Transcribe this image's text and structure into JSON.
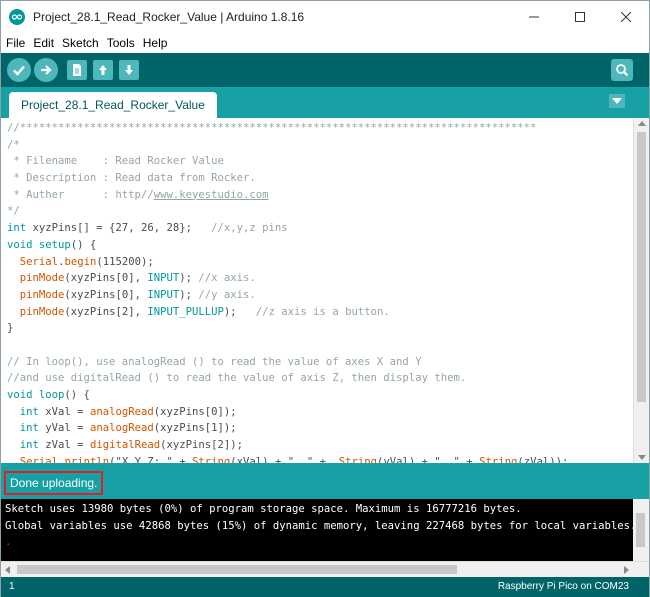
{
  "window": {
    "title": "Project_28.1_Read_Rocker_Value | Arduino 1.8.16"
  },
  "menu": [
    "File",
    "Edit",
    "Sketch",
    "Tools",
    "Help"
  ],
  "toolbar": {
    "verify_icon": "check-icon",
    "upload_icon": "arrow-right-icon",
    "new_icon": "document-icon",
    "open_icon": "arrow-up-icon",
    "save_icon": "arrow-down-icon",
    "serial_icon": "magnifier-icon"
  },
  "tab": {
    "label": "Project_28.1_Read_Rocker_Value"
  },
  "code_lines": [
    [
      [
        "c-comment",
        "//*********************************************************************************"
      ]
    ],
    [
      [
        "c-comment",
        "/*"
      ]
    ],
    [
      [
        "c-comment",
        " * Filename    : Read Rocker Value"
      ]
    ],
    [
      [
        "c-comment",
        " * Description : Read data from Rocker."
      ]
    ],
    [
      [
        "c-comment",
        " * Auther      : http//"
      ],
      [
        "c-url",
        "www.keyestudio.com"
      ]
    ],
    [
      [
        "c-comment",
        "*/"
      ]
    ],
    [
      [
        "c-kw",
        "int"
      ],
      [
        "c-plain",
        " xyzPins[] = {27, 26, 28};   "
      ],
      [
        "c-comment",
        "//x,y,z pins"
      ]
    ],
    [
      [
        "c-kw",
        "void"
      ],
      [
        "c-plain",
        " "
      ],
      [
        "c-kw",
        "setup"
      ],
      [
        "c-plain",
        "() {"
      ]
    ],
    [
      [
        "c-plain",
        "  "
      ],
      [
        "c-fn",
        "Serial"
      ],
      [
        "c-plain",
        "."
      ],
      [
        "c-fn",
        "begin"
      ],
      [
        "c-plain",
        "(115200);"
      ]
    ],
    [
      [
        "c-plain",
        "  "
      ],
      [
        "c-fn",
        "pinMode"
      ],
      [
        "c-plain",
        "(xyzPins[0], "
      ],
      [
        "c-kw",
        "INPUT"
      ],
      [
        "c-plain",
        "); "
      ],
      [
        "c-comment",
        "//x axis."
      ]
    ],
    [
      [
        "c-plain",
        "  "
      ],
      [
        "c-fn",
        "pinMode"
      ],
      [
        "c-plain",
        "(xyzPins[0], "
      ],
      [
        "c-kw",
        "INPUT"
      ],
      [
        "c-plain",
        "); "
      ],
      [
        "c-comment",
        "//y axis."
      ]
    ],
    [
      [
        "c-plain",
        "  "
      ],
      [
        "c-fn",
        "pinMode"
      ],
      [
        "c-plain",
        "(xyzPins[2], "
      ],
      [
        "c-kw",
        "INPUT_PULLUP"
      ],
      [
        "c-plain",
        ");   "
      ],
      [
        "c-comment",
        "//z axis is a button."
      ]
    ],
    [
      [
        "c-plain",
        "}"
      ]
    ],
    [
      [
        "c-plain",
        ""
      ]
    ],
    [
      [
        "c-comment",
        "// In loop(), use analogRead () to read the value of axes X and Y"
      ]
    ],
    [
      [
        "c-comment",
        "//and use digitalRead () to read the value of axis Z, then display them."
      ]
    ],
    [
      [
        "c-kw",
        "void"
      ],
      [
        "c-plain",
        " "
      ],
      [
        "c-kw",
        "loop"
      ],
      [
        "c-plain",
        "() {"
      ]
    ],
    [
      [
        "c-plain",
        "  "
      ],
      [
        "c-kw",
        "int"
      ],
      [
        "c-plain",
        " xVal = "
      ],
      [
        "c-fn",
        "analogRead"
      ],
      [
        "c-plain",
        "(xyzPins[0]);"
      ]
    ],
    [
      [
        "c-plain",
        "  "
      ],
      [
        "c-kw",
        "int"
      ],
      [
        "c-plain",
        " yVal = "
      ],
      [
        "c-fn",
        "analogRead"
      ],
      [
        "c-plain",
        "(xyzPins[1]);"
      ]
    ],
    [
      [
        "c-plain",
        "  "
      ],
      [
        "c-kw",
        "int"
      ],
      [
        "c-plain",
        " zVal = "
      ],
      [
        "c-fn",
        "digitalRead"
      ],
      [
        "c-plain",
        "(xyzPins[2]);"
      ]
    ],
    [
      [
        "c-plain",
        "  "
      ],
      [
        "c-fn",
        "Serial"
      ],
      [
        "c-plain",
        "."
      ],
      [
        "c-fn",
        "println"
      ],
      [
        "c-plain",
        "(\"X,Y,Z: \" + "
      ],
      [
        "c-fn",
        "String"
      ],
      [
        "c-plain",
        "(xVal) + \", \" +  "
      ],
      [
        "c-fn",
        "String"
      ],
      [
        "c-plain",
        "(yVal) + \", \" + "
      ],
      [
        "c-fn",
        "String"
      ],
      [
        "c-plain",
        "(zVal));"
      ]
    ]
  ],
  "status": {
    "message": "Done uploading."
  },
  "console": {
    "line1": "Sketch uses 13980 bytes (0%) of program storage space. Maximum is 16777216 bytes.",
    "line2": "Global variables use 42868 bytes (15%) of dynamic memory, leaving 227468 bytes for local variables.",
    "line3": "."
  },
  "footer": {
    "line_number": "1",
    "board": "Raspberry Pi Pico on COM23"
  },
  "colors": {
    "toolbar": "#006468",
    "tabbar": "#17a1a5",
    "highlight": "#e21e26"
  }
}
